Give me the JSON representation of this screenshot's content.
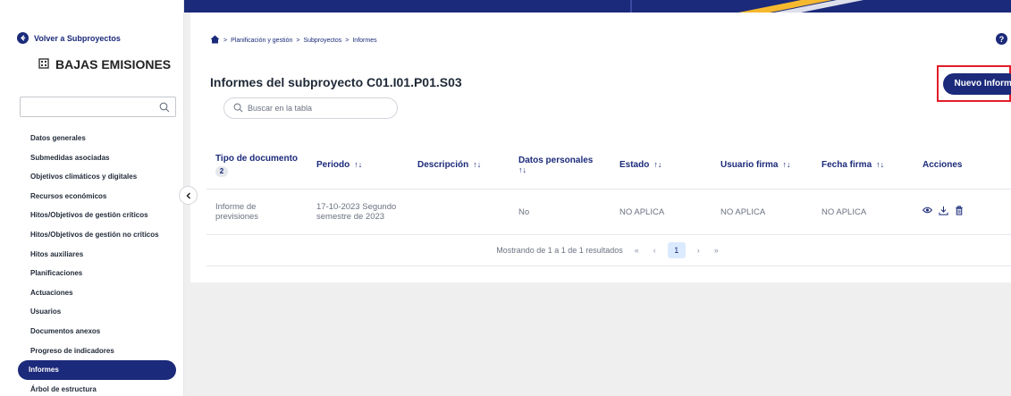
{
  "sidebar": {
    "back_label": "Volver a Subproyectos",
    "project_name": "BAJAS EMISIONES",
    "search_placeholder": "",
    "items": [
      {
        "label": "Datos generales"
      },
      {
        "label": "Submedidas asociadas"
      },
      {
        "label": "Objetivos climáticos y digitales"
      },
      {
        "label": "Recursos económicos"
      },
      {
        "label": "Hitos/Objetivos de gestión críticos"
      },
      {
        "label": "Hitos/Objetivos de gestión no críticos"
      },
      {
        "label": "Hitos auxiliares"
      },
      {
        "label": "Planificaciones"
      },
      {
        "label": "Actuaciones"
      },
      {
        "label": "Usuarios"
      },
      {
        "label": "Documentos anexos"
      },
      {
        "label": "Progreso de indicadores"
      },
      {
        "label": "Informes"
      },
      {
        "label": "Árbol de estructura"
      }
    ],
    "active_item": "Informes"
  },
  "breadcrumb": {
    "items": [
      "Planificación y gestión",
      "Subproyectos",
      "Informes"
    ],
    "separator": ">"
  },
  "help_label": "?",
  "main": {
    "title": "Informes del subproyecto C01.I01.P01.S03",
    "new_button_label": "Nuevo Informe",
    "table_search_placeholder": "Buscar en la tabla"
  },
  "table": {
    "columns": [
      {
        "label": "Tipo de documento",
        "badge": "2"
      },
      {
        "label": "Periodo",
        "sort": "↑↓"
      },
      {
        "label": "Descripción",
        "sort": "↑↓"
      },
      {
        "label": "Datos personales",
        "sort": "↑↓"
      },
      {
        "label": "Estado",
        "sort": "↑↓"
      },
      {
        "label": "Usuario firma",
        "sort": "↑↓"
      },
      {
        "label": "Fecha firma",
        "sort": "↑↓"
      },
      {
        "label": "Acciones"
      }
    ],
    "rows": [
      {
        "tipo": "Informe de previsiones",
        "periodo": "17-10-2023 Segundo semestre de 2023",
        "descripcion": "",
        "datos_personales": "No",
        "estado": "NO APLICA",
        "usuario_firma": "NO APLICA",
        "fecha_firma": "NO APLICA"
      }
    ]
  },
  "pagination": {
    "summary": "Mostrando de 1 a 1 de 1 resultados",
    "first": "«",
    "prev": "‹",
    "current_page": "1",
    "next": "›",
    "last": "»"
  },
  "colors": {
    "primary": "#1b2a7a",
    "highlight_border": "#e11d2a",
    "accent_stripe": "#f5b82e"
  }
}
